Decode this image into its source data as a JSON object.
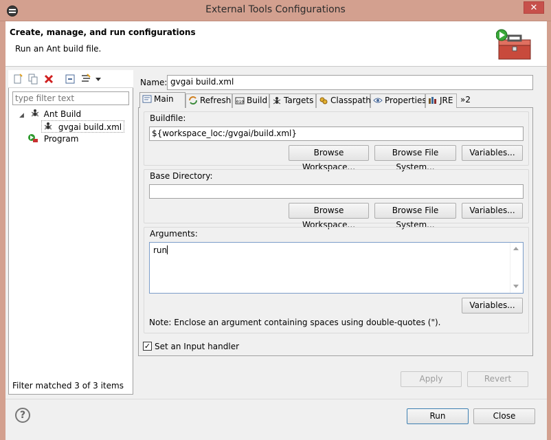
{
  "window": {
    "title": "External Tools Configurations",
    "close_label": "✕"
  },
  "header": {
    "title": "Create, manage, and run configurations",
    "description": "Run an Ant build file."
  },
  "left_panel": {
    "filter_placeholder": "type filter text",
    "tree": [
      {
        "label": "Ant Build",
        "icon": "ant-icon",
        "expanded": true
      },
      {
        "label": "gvgai build.xml",
        "icon": "ant-file-icon",
        "selected": true
      },
      {
        "label": "Program",
        "icon": "program-icon"
      }
    ],
    "filter_status": "Filter matched 3 of 3 items",
    "toolbar_icons": [
      "new-config-icon",
      "duplicate-icon",
      "delete-icon",
      "collapse-all-icon",
      "filter-icon",
      "dropdown-icon"
    ]
  },
  "config": {
    "name_label": "Name:",
    "name_value": "gvgai build.xml",
    "tabs": [
      {
        "label": "Main",
        "icon": "main-tab-icon",
        "active": true
      },
      {
        "label": "Refresh",
        "icon": "refresh-icon"
      },
      {
        "label": "Build",
        "icon": "build-icon"
      },
      {
        "label": "Targets",
        "icon": "targets-icon"
      },
      {
        "label": "Classpath",
        "icon": "classpath-icon"
      },
      {
        "label": "Properties",
        "icon": "properties-icon"
      },
      {
        "label": "JRE",
        "icon": "jre-icon"
      }
    ],
    "more_tabs": "»2",
    "buildfile": {
      "label": "Buildfile:",
      "value": "${workspace_loc:/gvgai/build.xml}",
      "browse_workspace": "Browse Workspace...",
      "browse_filesystem": "Browse File System...",
      "variables": "Variables..."
    },
    "base_directory": {
      "label": "Base Directory:",
      "value": "",
      "browse_workspace": "Browse Workspace...",
      "browse_filesystem": "Browse File System...",
      "variables": "Variables..."
    },
    "arguments": {
      "label": "Arguments:",
      "value": "run",
      "variables": "Variables..."
    },
    "note": "Note: Enclose an argument containing spaces using double-quotes (\").",
    "input_handler": {
      "label": "Set an Input handler",
      "checked": true,
      "mark": "✓"
    }
  },
  "actions": {
    "apply": "Apply",
    "revert": "Revert",
    "run": "Run",
    "close": "Close",
    "help": "?"
  },
  "colors": {
    "titlebar": "#d3a08f",
    "close_button": "#c7504b",
    "dialog_bg": "#f0f0f0"
  }
}
